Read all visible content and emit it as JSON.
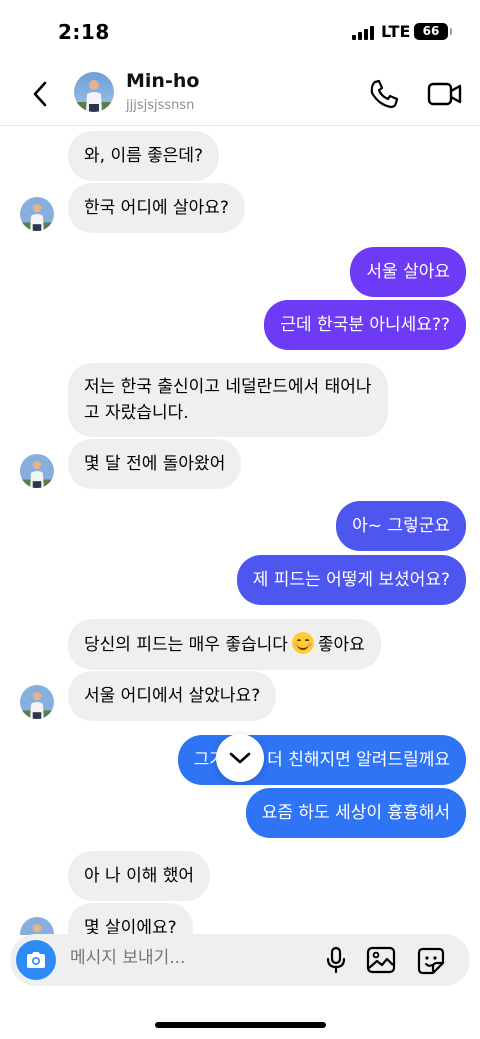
{
  "status_bar": {
    "time": "2:18",
    "network": "LTE",
    "battery": "66"
  },
  "header": {
    "contact_name": "Min-ho",
    "contact_handle": "jjjsjsjssnsn",
    "back_icon": "chevron-left-icon",
    "call_icon": "phone-icon",
    "video_icon": "video-camera-icon"
  },
  "messages": [
    {
      "side": "in",
      "text": "와, 이름 좋은데?"
    },
    {
      "side": "in",
      "text": "한국 어디에 살아요?"
    },
    {
      "side": "out",
      "text": "서울 살아요"
    },
    {
      "side": "out",
      "text": "근데 한국분 아니세요??"
    },
    {
      "side": "in",
      "text_line1": "저는 한국 출신이고 네덜란드에서 태어나",
      "text_line2": "고 자랐습니다."
    },
    {
      "side": "in",
      "text": "몇 달 전에 돌아왔어"
    },
    {
      "side": "out",
      "text": "아~ 그렇군요"
    },
    {
      "side": "out",
      "text": "제 피드는 어떻게 보셨어요?"
    },
    {
      "side": "in",
      "text_before": "당신의 피드는 매우 좋습니다",
      "emoji": "smiling-face-emoji",
      "text_after": "좋아요"
    },
    {
      "side": "in",
      "text": "서울 어디에서 살았나요?"
    },
    {
      "side": "out",
      "text": "그거는 좀 더 친해지면 알려드릴께요"
    },
    {
      "side": "out",
      "text": "요즘 하도 세상이 흉흉해서"
    },
    {
      "side": "in",
      "text": "아 나 이해 했어"
    },
    {
      "side": "in",
      "text": "몇 살이에요?"
    }
  ],
  "composer": {
    "placeholder": "메시지 보내기...",
    "camera_icon": "camera-icon",
    "mic_icon": "microphone-icon",
    "gallery_icon": "image-icon",
    "sticker_icon": "sticker-icon"
  },
  "colors": {
    "incoming_bubble": "#efefef",
    "outgoing_purple": "#6d3bf5",
    "outgoing_indigo": "#4e56f0",
    "outgoing_blue": "#2e74f5",
    "camera_button": "#2e8bf5"
  }
}
